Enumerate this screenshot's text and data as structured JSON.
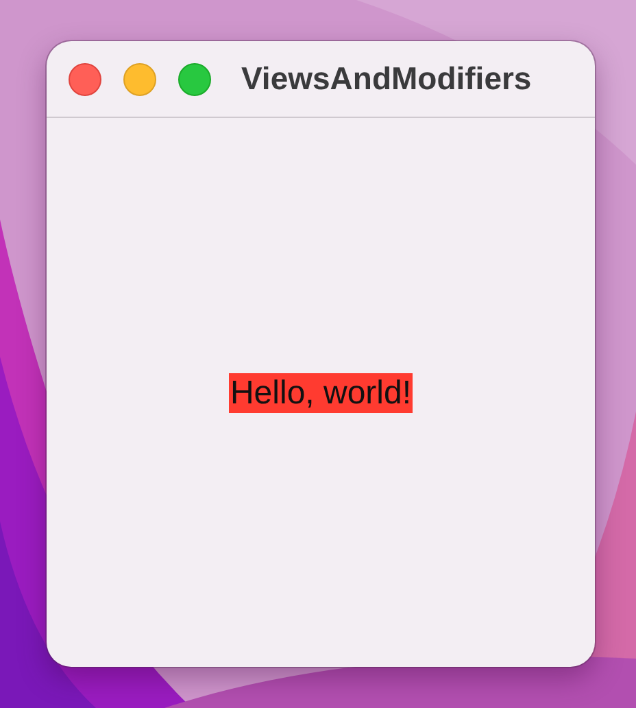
{
  "window": {
    "title": "ViewsAndModifiers"
  },
  "content": {
    "text": "Hello, world!"
  }
}
